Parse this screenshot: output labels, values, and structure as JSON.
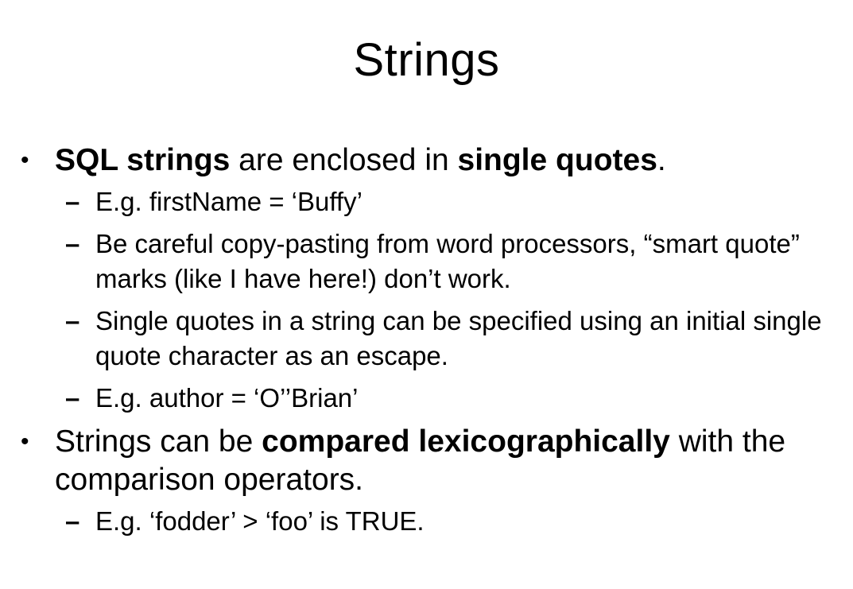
{
  "slide": {
    "title": "Strings",
    "bullets": [
      {
        "segments": [
          {
            "text": "SQL strings",
            "bold": true
          },
          {
            "text": " are enclosed in ",
            "bold": false
          },
          {
            "text": "single quotes",
            "bold": true
          },
          {
            "text": ".",
            "bold": false
          }
        ],
        "subitems": [
          "E.g. firstName = ‘Buffy’",
          "Be careful copy-pasting from word processors, “smart quote” marks (like I have here!) don’t work.",
          "Single quotes in a string can be specified using an initial single quote character as an escape.",
          "E.g. author = ‘O’’Brian’"
        ]
      },
      {
        "segments": [
          {
            "text": "Strings can be ",
            "bold": false
          },
          {
            "text": "compared lexicographically",
            "bold": true
          },
          {
            "text": " with the comparison operators.",
            "bold": false
          }
        ],
        "subitems": [
          "E.g. ‘fodder’ > ‘foo’ is TRUE."
        ]
      }
    ],
    "bullet_glyph": "•",
    "dash_glyph": "–"
  }
}
